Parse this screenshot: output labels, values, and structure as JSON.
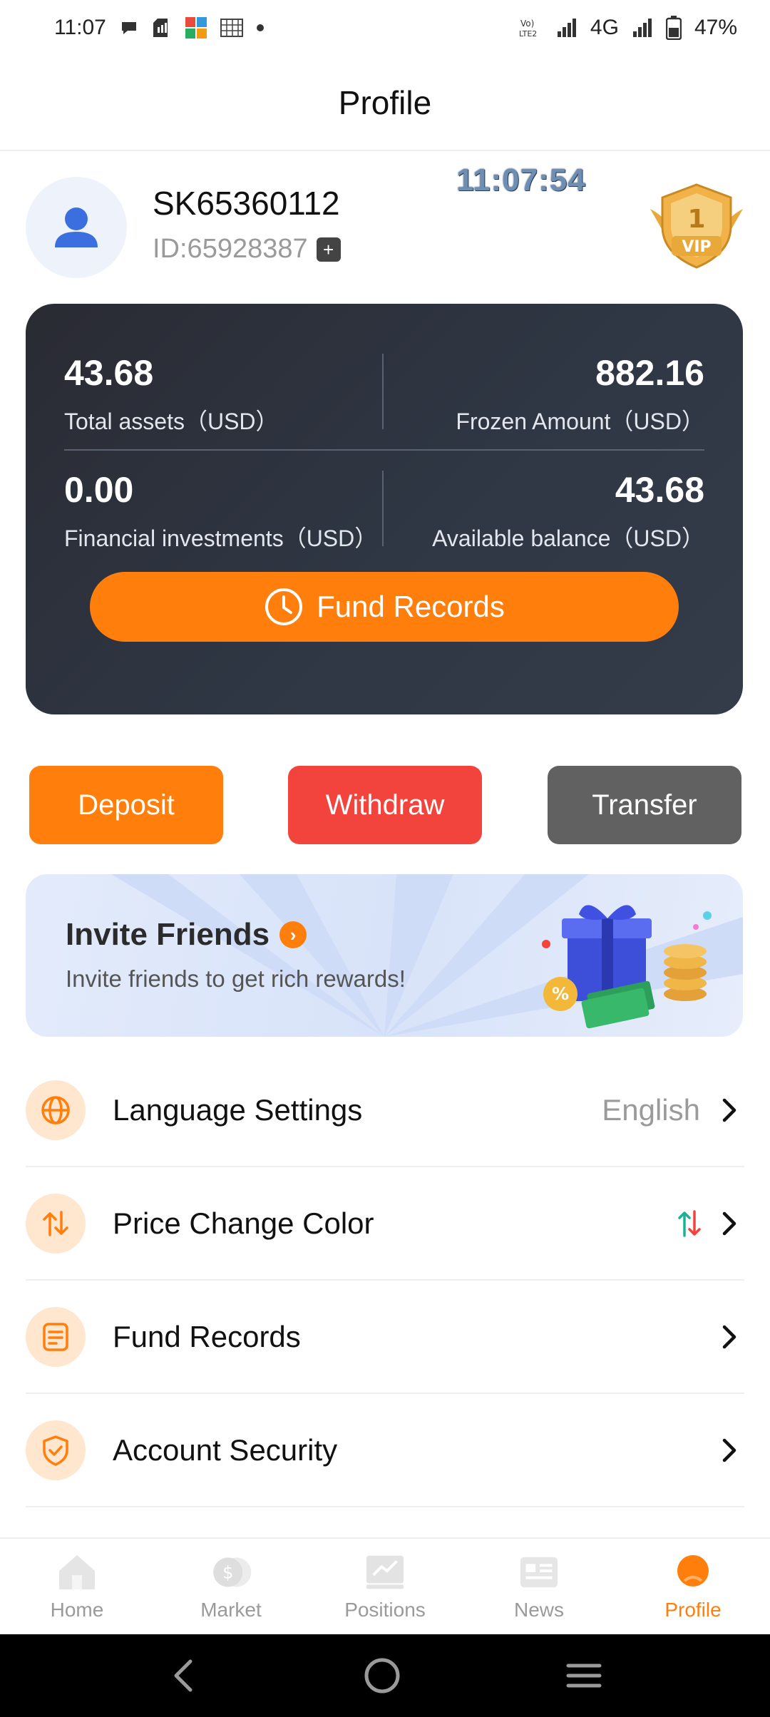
{
  "status_bar": {
    "time": "11:07",
    "battery": "47%",
    "network": "4G",
    "volte": "Vo) LTE2"
  },
  "header": {
    "title": "Profile"
  },
  "profile": {
    "username": "SK65360112",
    "user_id": "ID:65928387",
    "clock": "11:07:54",
    "vip_level": "1",
    "vip_label": "VIP"
  },
  "assets": {
    "total_assets_value": "43.68",
    "total_assets_label": "Total assets（USD）",
    "frozen_amount_value": "882.16",
    "frozen_amount_label": "Frozen Amount（USD）",
    "financial_investments_value": "0.00",
    "financial_investments_label": "Financial investments（USD）",
    "available_balance_value": "43.68",
    "available_balance_label": "Available balance（USD）",
    "fund_records_button": "Fund Records"
  },
  "actions": {
    "deposit": "Deposit",
    "withdraw": "Withdraw",
    "transfer": "Transfer"
  },
  "invite": {
    "title": "Invite Friends",
    "subtitle": "Invite friends to get rich rewards!"
  },
  "settings": {
    "language_label": "Language Settings",
    "language_value": "English",
    "price_change_label": "Price Change Color",
    "fund_records_label": "Fund Records",
    "account_security_label": "Account Security"
  },
  "bottom_nav": {
    "home": "Home",
    "market": "Market",
    "positions": "Positions",
    "news": "News",
    "profile": "Profile"
  },
  "colors": {
    "accent": "#ff7e0c",
    "withdraw": "#f2443c",
    "transfer": "#616161",
    "card": "#2f3744",
    "price_up": "#19b394",
    "price_down": "#f2443c"
  }
}
